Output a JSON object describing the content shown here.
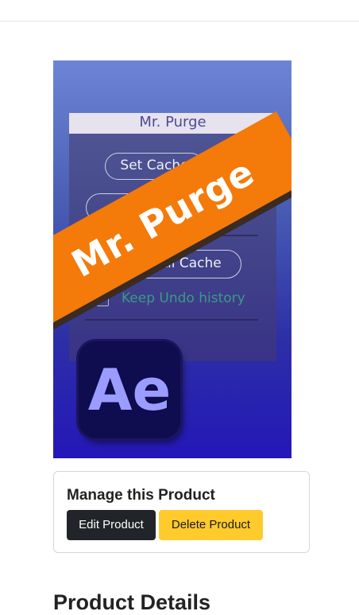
{
  "product_image": {
    "panel_title": "Mr. Purge",
    "panel_buttons": [
      "Set Cache",
      "",
      "Purge All Cache"
    ],
    "checkbox_label": "Keep Undo history",
    "banner_text": "Mr. Purge",
    "app_icon_text": "Ae",
    "colors": {
      "banner": "#f47a0a",
      "background_top": "#6d85d6",
      "background_bottom": "#2417b8",
      "icon": "#0f0c4f"
    }
  },
  "manage": {
    "title": "Manage this Product",
    "edit_label": "Edit Product",
    "delete_label": "Delete Product",
    "colors": {
      "edit": "#212529",
      "delete": "#ffca2c"
    }
  },
  "details": {
    "heading": "Product Details"
  }
}
